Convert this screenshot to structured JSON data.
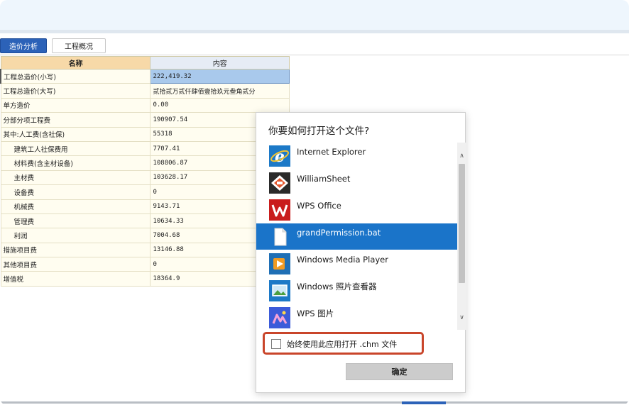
{
  "tabs": [
    {
      "label": "造价分析",
      "active": true
    },
    {
      "label": "工程概况",
      "active": false
    }
  ],
  "grid": {
    "headers": [
      "名称",
      "内容"
    ],
    "rows": [
      {
        "name": "工程总造价(小写)",
        "value": "222,419.32",
        "indent": false
      },
      {
        "name": "工程总造价(大写)",
        "value": "贰拾贰万贰仟肆佰壹拾玖元叁角贰分",
        "indent": false
      },
      {
        "name": "单方造价",
        "value": "0.00",
        "indent": false
      },
      {
        "name": "分部分项工程费",
        "value": "190907.54",
        "indent": false
      },
      {
        "name": "其中:人工费(含社保)",
        "value": "55318",
        "indent": false
      },
      {
        "name": "建筑工人社保费用",
        "value": "7707.41",
        "indent": true
      },
      {
        "name": "材料费(含主材设备)",
        "value": "108806.87",
        "indent": true
      },
      {
        "name": "主材费",
        "value": "103628.17",
        "indent": true
      },
      {
        "name": "设备费",
        "value": "0",
        "indent": true
      },
      {
        "name": "机械费",
        "value": "9143.71",
        "indent": true
      },
      {
        "name": "管理费",
        "value": "10634.33",
        "indent": true
      },
      {
        "name": "利润",
        "value": "7004.68",
        "indent": true
      },
      {
        "name": "措施项目费",
        "value": "13146.88",
        "indent": false
      },
      {
        "name": "其他项目费",
        "value": "0",
        "indent": false
      },
      {
        "name": "增值税",
        "value": "18364.9",
        "indent": false
      }
    ]
  },
  "dialog": {
    "title": "你要如何打开这个文件?",
    "apps": [
      {
        "label": "Internet Explorer",
        "icon": "internet-explorer-icon"
      },
      {
        "label": "WilliamSheet",
        "icon": "williamsheet-icon"
      },
      {
        "label": "WPS Office",
        "icon": "wps-office-icon"
      },
      {
        "label": "grandPermission.bat",
        "icon": "file-icon",
        "selected": true
      },
      {
        "label": "Windows Media Player",
        "icon": "media-player-icon"
      },
      {
        "label": "Windows 照片查看器",
        "icon": "photo-viewer-icon"
      },
      {
        "label": "WPS 图片",
        "icon": "wps-picture-icon"
      }
    ],
    "always_label": "始终使用此应用打开 .chm 文件",
    "always_checked": false,
    "ok_label": "确定"
  },
  "colors": {
    "accent": "#1a74c9",
    "tab_active": "#2c62b8",
    "highlight_border": "#c9452a"
  }
}
